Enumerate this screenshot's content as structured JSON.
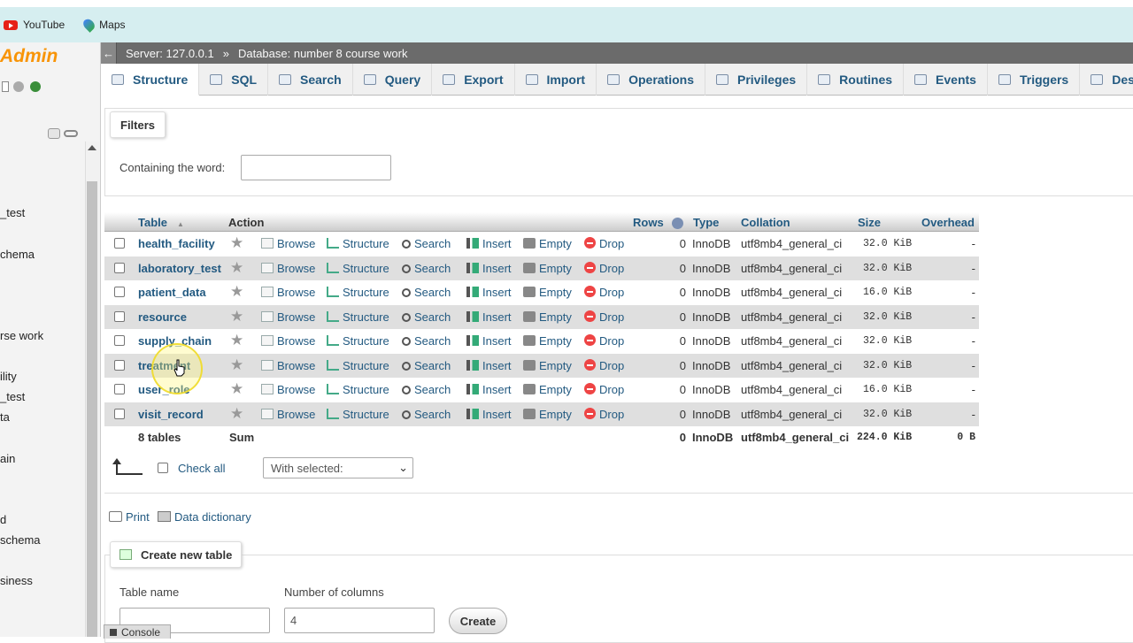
{
  "bookmarks": [
    {
      "label": "YouTube",
      "icon": "youtube-icon"
    },
    {
      "label": "Maps",
      "icon": "maps-icon"
    }
  ],
  "sidebar": {
    "logo": "Admin",
    "items": [
      "_test",
      "chema",
      "rse work",
      "ility",
      "_test",
      "ta",
      "ain",
      "d",
      "schema",
      "siness"
    ]
  },
  "breadcrumb": {
    "server": "Server: 127.0.0.1",
    "separator": "»",
    "database": "Database: number 8 course work"
  },
  "tabs": [
    "Structure",
    "SQL",
    "Search",
    "Query",
    "Export",
    "Import",
    "Operations",
    "Privileges",
    "Routines",
    "Events",
    "Triggers",
    "Designer"
  ],
  "filters": {
    "legend": "Filters",
    "label": "Containing the word:",
    "value": ""
  },
  "table": {
    "headers": {
      "table": "Table",
      "sort_arrow": "▲",
      "action": "Action",
      "rows": "Rows",
      "type": "Type",
      "collation": "Collation",
      "size": "Size",
      "overhead": "Overhead"
    },
    "actions": {
      "browse": "Browse",
      "structure": "Structure",
      "search": "Search",
      "insert": "Insert",
      "empty": "Empty",
      "drop": "Drop"
    },
    "rows": [
      {
        "name": "health_facility",
        "rows": "0",
        "type": "InnoDB",
        "collation": "utf8mb4_general_ci",
        "size": "32.0 KiB",
        "overhead": "-"
      },
      {
        "name": "laboratory_test",
        "rows": "0",
        "type": "InnoDB",
        "collation": "utf8mb4_general_ci",
        "size": "32.0 KiB",
        "overhead": "-"
      },
      {
        "name": "patient_data",
        "rows": "0",
        "type": "InnoDB",
        "collation": "utf8mb4_general_ci",
        "size": "16.0 KiB",
        "overhead": "-"
      },
      {
        "name": "resource",
        "rows": "0",
        "type": "InnoDB",
        "collation": "utf8mb4_general_ci",
        "size": "32.0 KiB",
        "overhead": "-"
      },
      {
        "name": "supply_chain",
        "rows": "0",
        "type": "InnoDB",
        "collation": "utf8mb4_general_ci",
        "size": "32.0 KiB",
        "overhead": "-"
      },
      {
        "name": "treatment",
        "rows": "0",
        "type": "InnoDB",
        "collation": "utf8mb4_general_ci",
        "size": "32.0 KiB",
        "overhead": "-"
      },
      {
        "name": "user_role",
        "rows": "0",
        "type": "InnoDB",
        "collation": "utf8mb4_general_ci",
        "size": "16.0 KiB",
        "overhead": "-"
      },
      {
        "name": "visit_record",
        "rows": "0",
        "type": "InnoDB",
        "collation": "utf8mb4_general_ci",
        "size": "32.0 KiB",
        "overhead": "-"
      }
    ],
    "summary": {
      "count": "8 tables",
      "label": "Sum",
      "rows": "0",
      "type": "InnoDB",
      "collation": "utf8mb4_general_ci",
      "size": "224.0 KiB",
      "overhead": "0 B"
    }
  },
  "bulk": {
    "check_all": "Check all",
    "with_selected": "With selected:"
  },
  "links": {
    "print": "Print",
    "data_dictionary": "Data dictionary"
  },
  "create_table": {
    "legend": "Create new table",
    "table_name_label": "Table name",
    "table_name_value": "",
    "num_columns_label": "Number of columns",
    "num_columns_value": "4",
    "button": "Create"
  },
  "console": {
    "label": "Console"
  }
}
